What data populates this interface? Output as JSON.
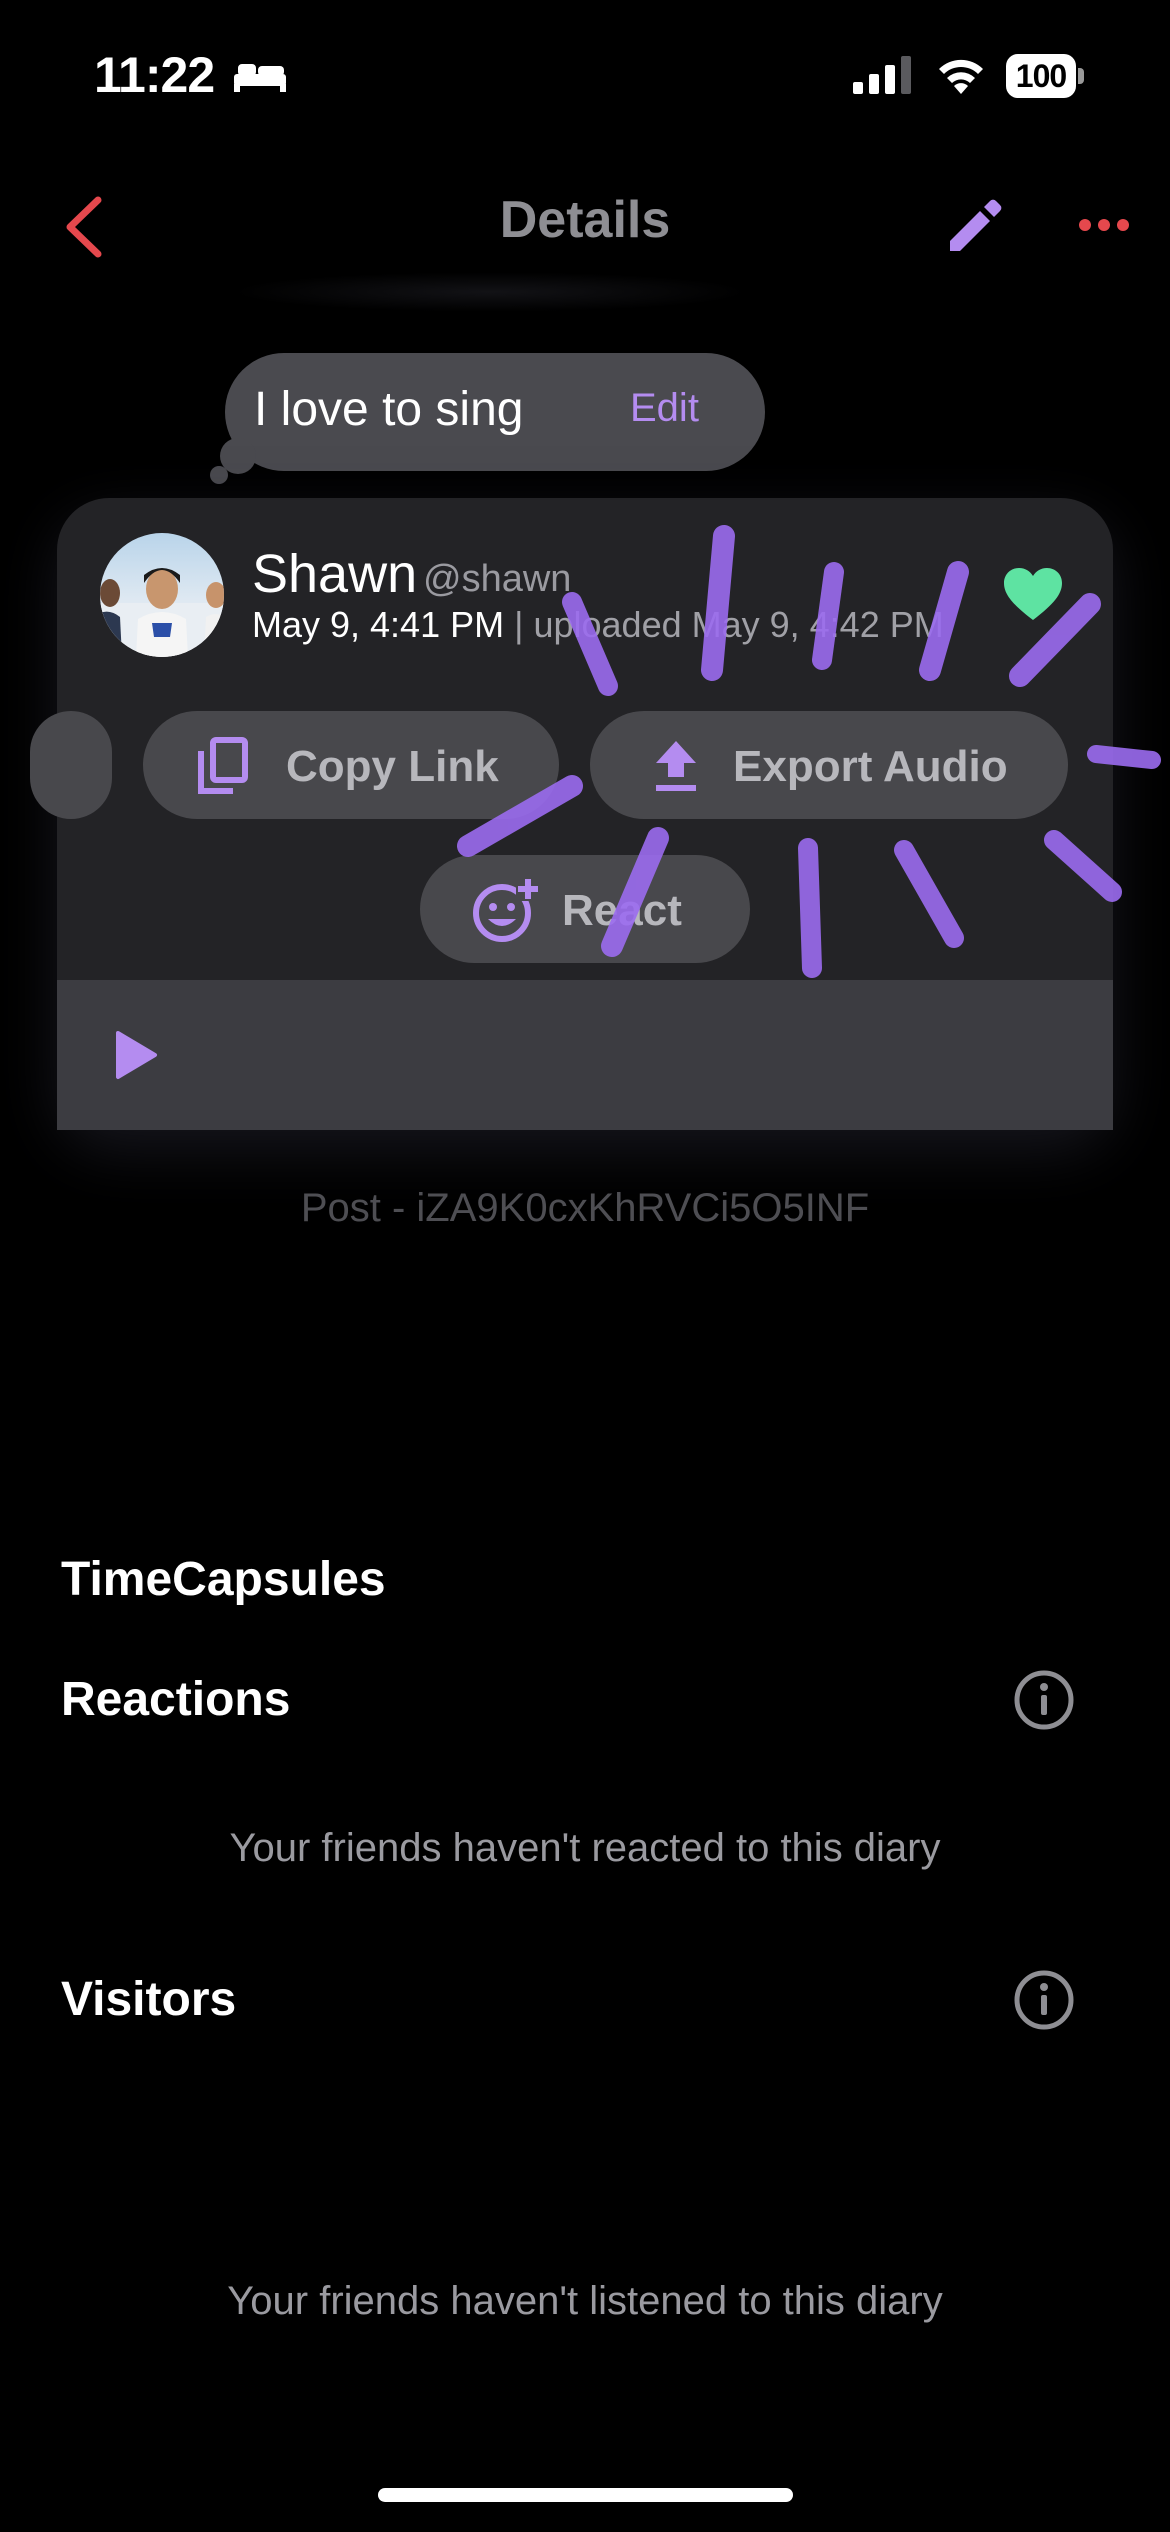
{
  "status_bar": {
    "time": "11:22",
    "battery": "100"
  },
  "nav": {
    "title": "Details"
  },
  "caption": {
    "text": "I love to sing",
    "edit_label": "Edit"
  },
  "post": {
    "user_name": "Shawn",
    "handle": "@shawn",
    "recorded": "May 9, 4:41 PM",
    "separator": " | ",
    "uploaded": "uploaded May 9, 4:42 PM",
    "liked": true
  },
  "actions": {
    "copy_link": "Copy Link",
    "export_audio": "Export Audio",
    "react": "React"
  },
  "post_id": "Post - iZA9K0cxKhRVCi5O5INF",
  "sections": {
    "timecapsules_title": "TimeCapsules",
    "reactions_title": "Reactions",
    "reactions_empty": "Your friends haven't reacted to this diary",
    "visitors_title": "Visitors",
    "visitors_empty": "Your friends haven't listened to this diary"
  },
  "colors": {
    "accent_purple": "#b48cf0",
    "back_red": "#e5484d",
    "heart_green": "#5ee3a2",
    "card_bg": "#232326",
    "pill_bg": "#48484c"
  }
}
